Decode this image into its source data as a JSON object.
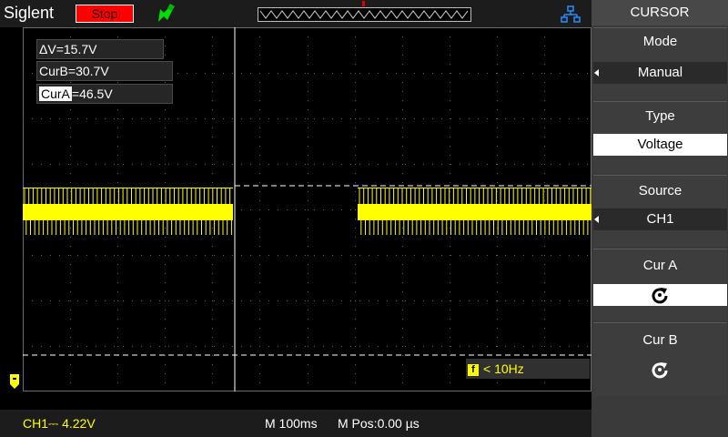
{
  "header": {
    "brand": "Siglent",
    "run_state": "Stop",
    "icons": [
      "trigger-probe-icon",
      "network-icon"
    ]
  },
  "cursor_readouts": {
    "delta_v": "ΔV=15.7V",
    "cur_b": "CurB=30.7V",
    "cur_a_label": "CurA",
    "cur_a_value": "=46.5V"
  },
  "frequency": {
    "badge": "f",
    "text": "< 10Hz"
  },
  "status": {
    "ch1": "CH1⎓ 4.22V",
    "timebase": "M 100ms",
    "mpos": "M Pos:0.00 µs"
  },
  "menu": {
    "title": "CURSOR",
    "mode_label": "Mode",
    "mode_value": "Manual",
    "type_label": "Type",
    "type_value": "Voltage",
    "source_label": "Source",
    "source_value": "CH1",
    "cur_a_label": "Cur A",
    "cur_b_label": "Cur B",
    "knob_icon": "rotate-knob-icon"
  },
  "colors": {
    "trace": "#ffff00",
    "stop": "#ff0000",
    "cursor_line": "#ffffff"
  }
}
